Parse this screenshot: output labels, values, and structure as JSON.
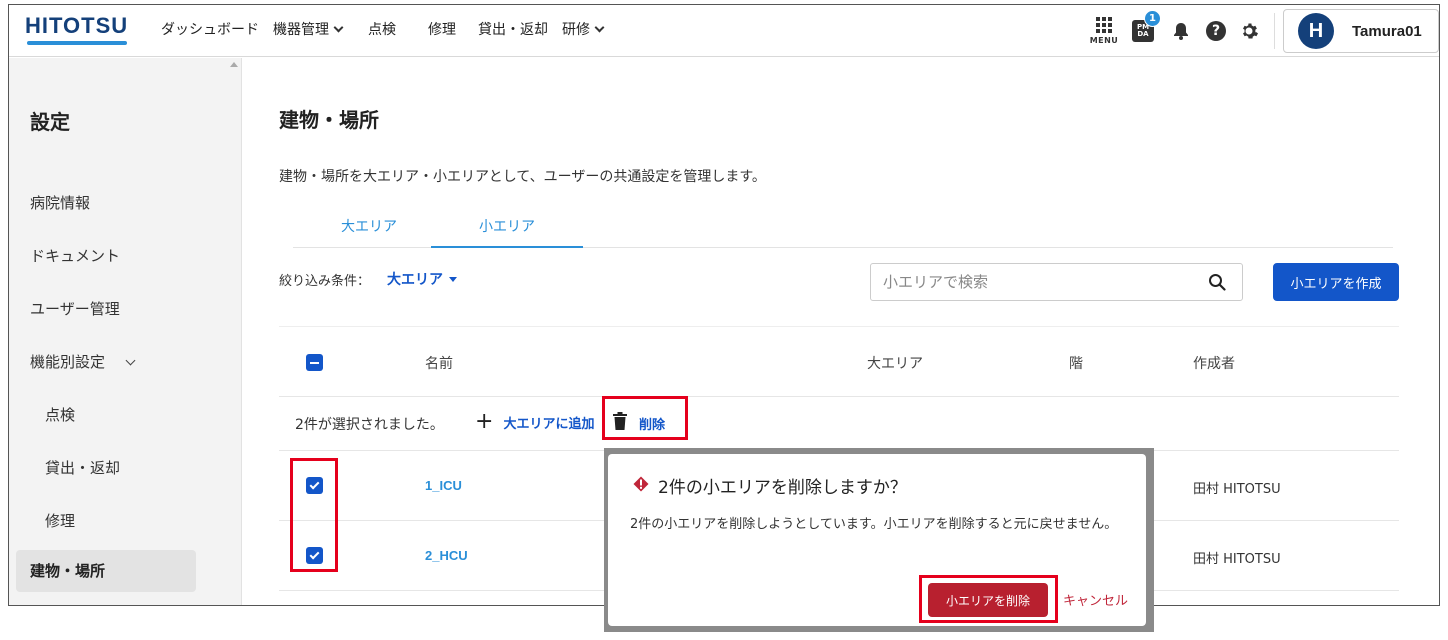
{
  "header": {
    "logo": "HITOTSU",
    "nav": [
      {
        "label": "ダッシュボード",
        "dropdown": false
      },
      {
        "label": "機器管理",
        "dropdown": true
      },
      {
        "label": "点検",
        "dropdown": false
      },
      {
        "label": "修理",
        "dropdown": false
      },
      {
        "label": "貸出・返却",
        "dropdown": false
      },
      {
        "label": "研修",
        "dropdown": true
      }
    ],
    "menu_label": "MENU",
    "pmda_label_top": "PM",
    "pmda_label_bottom": "DA",
    "notification_badge": "1",
    "help_glyph": "?",
    "user_initial": "H",
    "user_name": "Tamura01"
  },
  "sidebar": {
    "title": "設定",
    "items": [
      {
        "label": "病院情報"
      },
      {
        "label": "ドキュメント"
      },
      {
        "label": "ユーザー管理"
      },
      {
        "label": "機能別設定"
      },
      {
        "label": "点検"
      },
      {
        "label": "貸出・返却"
      },
      {
        "label": "修理"
      },
      {
        "label": "建物・場所"
      }
    ],
    "active": "建物・場所"
  },
  "main": {
    "title": "建物・場所",
    "description": "建物・場所を大エリア・小エリアとして、ユーザーの共通設定を管理します。",
    "tabs": [
      {
        "label": "大エリア",
        "active": false
      },
      {
        "label": "小エリア",
        "active": true
      }
    ],
    "filter_label": "絞り込み条件：",
    "filter_value": "大エリア",
    "search_placeholder": "小エリアで検索",
    "create_button": "小エリアを作成",
    "table": {
      "columns": [
        "名前",
        "大エリア",
        "階",
        "作成者"
      ],
      "selection_text": "2件が選択されました。",
      "add_action": "大エリアに追加",
      "delete_action": "削除",
      "rows": [
        {
          "name": "1_ICU",
          "creator": "田村 HITOTSU",
          "checked": true
        },
        {
          "name": "2_HCU",
          "creator": "田村 HITOTSU",
          "checked": true
        }
      ]
    }
  },
  "modal": {
    "title": "2件の小エリアを削除しますか？",
    "body": "2件の小エリアを削除しようとしています。小エリアを削除すると元に戻せません。",
    "confirm_button": "小エリアを削除",
    "cancel_button": "キャンセル"
  },
  "colors": {
    "primary": "#1356c9",
    "link": "#2a8fd8",
    "brand": "#14407a",
    "danger": "#b8202f",
    "highlight": "#e5001c"
  },
  "icons": [
    "menu-grid-icon",
    "pmda-icon",
    "bell-icon",
    "help-icon",
    "gear-icon",
    "search-icon",
    "plus-icon",
    "trash-icon",
    "warning-icon",
    "chevron-down-icon"
  ]
}
